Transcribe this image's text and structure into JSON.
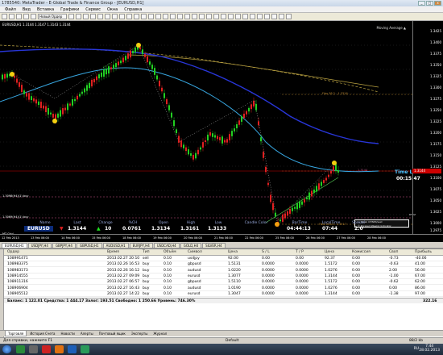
{
  "window": {
    "title": "1785540: MetaTrader - E-Global Trade & Finance Group - [EURUSD,H1]",
    "min": "_",
    "max": "□",
    "close": "x"
  },
  "menu": [
    "Файл",
    "Вид",
    "Вставка",
    "Графики",
    "Сервис",
    "Окна",
    "Справка"
  ],
  "toolbar": {
    "new_order": "Новый Ордер"
  },
  "chart": {
    "title": "EURUSD,H1  1.3144 1.3147 1.3143 1.3144",
    "ma_label": "Moving Average ▲",
    "y_ticks": [
      "1.3425",
      "1.3400",
      "1.3375",
      "1.3350",
      "1.3325",
      "1.3300",
      "1.3275",
      "1.3250",
      "1.3225",
      "1.3200",
      "1.3175",
      "1.3150",
      "1.3125",
      "1.3100",
      "1.3075",
      "1.3050",
      "1.3025",
      "1.3000",
      "1.2975"
    ],
    "current_price": "1.3144",
    "x_ticks": [
      "12 Feb 2013",
      "13 Feb 06:00",
      "14 Feb 06:00",
      "15 Feb 06:00",
      "18 Feb 06:00",
      "19 Feb 06:00",
      "20 Feb 06:00",
      "21 Feb 06:00",
      "22 Feb 06:00",
      "25 Feb 06:00",
      "26 Feb 06:00",
      "27 Feb 06:00",
      "28 Feb 06:00"
    ],
    "time_left_label": "Time Left",
    "time_left_value": "00:15:47",
    "fib_upper": "Fibo 38.2 - 1.3316",
    "fib_lower": "Fibo 100.0 - 1.3917",
    "fib_right": "1.3144",
    "indicator_label_1": "1.3098(H4)(1) buy",
    "indicator_label_2": "1.3069(H4)(1) buy",
    "mt_label": "MT Grid",
    "weekly_box_line1": "— Week OHNIM/sest",
    "weekly_box_line2": "© Forexed Weekly Indicator",
    "rfuz": "RFUZ"
  },
  "info_panel": {
    "headers": [
      "Name",
      "Last",
      "Change",
      "%CH",
      "Open",
      "High",
      "Low",
      "Candle Color",
      "BarTime",
      "LocalTime",
      "Spread"
    ],
    "name": "EURUSD",
    "last_arrow": "▼",
    "last": "1.3144",
    "change_arrow": "▲",
    "change": "10",
    "pct_change": "0.0761",
    "open": "1.3134",
    "high": "1.3161",
    "low": "1.3133",
    "candle_color": "",
    "bar_time": "04:44:13",
    "local_time": "07:44",
    "spread": "2.0"
  },
  "symbol_tabs": [
    "EURUSD,H1",
    "USDJPY,H4",
    "GBPJPY,H4",
    "GBPUSD,H1",
    "AUDUSD,H1",
    "EURJPY,H4",
    "USDCAD,H4",
    "GOLD,H4",
    "SILVER,H4"
  ],
  "terminal": {
    "headers": [
      "Ордер",
      "Время",
      "Тип",
      "Объём",
      "Символ",
      "Цена",
      "S / L",
      "T / P",
      "Цена",
      "Комиссия",
      "Своп",
      "Прибыль"
    ],
    "rows": [
      {
        "order": "108991471",
        "time": "2013.02.27 20:10",
        "type": "sell",
        "volume": "0.10",
        "symbol": "usdjpy",
        "price": "92.00",
        "sl": "0.00",
        "tp": "0.00",
        "cur": "92.37",
        "commission": "0.00",
        "swap": "-0.73",
        "profit": "-40.06"
      },
      {
        "order": "108983375",
        "time": "2013.02.26 16:53",
        "type": "buy",
        "volume": "0.10",
        "symbol": "gbpusd",
        "price": "1.5131",
        "sl": "0.0000",
        "tp": "0.0000",
        "cur": "1.5172",
        "commission": "0.00",
        "swap": "-0.63",
        "profit": "41.00"
      },
      {
        "order": "108983173",
        "time": "2013.02.26 16:12",
        "type": "buy",
        "volume": "0.10",
        "symbol": "audusd",
        "price": "1.0220",
        "sl": "0.0000",
        "tp": "0.0000",
        "cur": "1.0276",
        "commission": "0.00",
        "swap": "2.00",
        "profit": "56.00"
      },
      {
        "order": "108914555",
        "time": "2013.02.27 09:09",
        "type": "buy",
        "volume": "0.10",
        "symbol": "eurusd",
        "price": "1.3077",
        "sl": "0.0000",
        "tp": "0.0000",
        "cur": "1.3144",
        "commission": "0.00",
        "swap": "-1.00",
        "profit": "67.00"
      },
      {
        "order": "108911316",
        "time": "2013.02.27 06:57",
        "type": "buy",
        "volume": "0.10",
        "symbol": "gbpusd",
        "price": "1.5110",
        "sl": "0.0000",
        "tp": "0.0000",
        "cur": "1.5172",
        "commission": "0.00",
        "swap": "-0.62",
        "profit": "62.00"
      },
      {
        "order": "108906904",
        "time": "2013.02.27 16:43",
        "type": "buy",
        "volume": "0.10",
        "symbol": "audusd",
        "price": "1.0190",
        "sl": "0.0000",
        "tp": "0.0000",
        "cur": "1.0276",
        "commission": "0.00",
        "swap": "0.00",
        "profit": "86.00"
      },
      {
        "order": "108905512",
        "time": "2013.02.27 14:22",
        "type": "buy",
        "volume": "0.10",
        "symbol": "eurusd",
        "price": "1.3047",
        "sl": "0.0000",
        "tp": "0.0000",
        "cur": "1.3144",
        "commission": "0.00",
        "swap": "-1.38",
        "profit": "97.00"
      }
    ],
    "balance_text": "Баланс: 1 122.01  Средства: 1 444.17  Залог: 193.51  Свободно: 1 250.66  Уровень: 746.30%",
    "balance_total": "322.16",
    "tabs": [
      "Торговля",
      "История Счета",
      "Новости",
      "Алерты",
      "Почтовый ящик",
      "Эксперты",
      "Журнал"
    ]
  },
  "status": {
    "left": "Для справки, нажмите F1",
    "mid": "Default",
    "right": "88/2 kb"
  },
  "taskbar": {
    "lang": "RU",
    "time": "7:44",
    "date": "28.02.2013"
  }
}
